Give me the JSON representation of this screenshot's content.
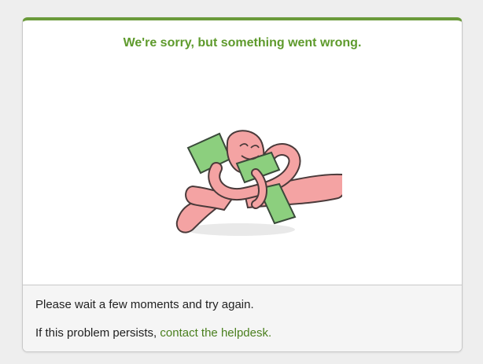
{
  "error_card": {
    "title": "We're sorry, but something went wrong.",
    "illustration": "pink-octopus-holding-money-icon",
    "message_wait": "Please wait a few moments and try again.",
    "message_persist_prefix": "If this problem persists, ",
    "helpdesk_link_label": "contact the helpdesk.",
    "colors": {
      "accent": "#6a9a3a",
      "title": "#5e9a2c",
      "link": "#4a7f1e",
      "footer_bg": "#f5f5f5",
      "page_bg": "#eeeeee"
    }
  }
}
